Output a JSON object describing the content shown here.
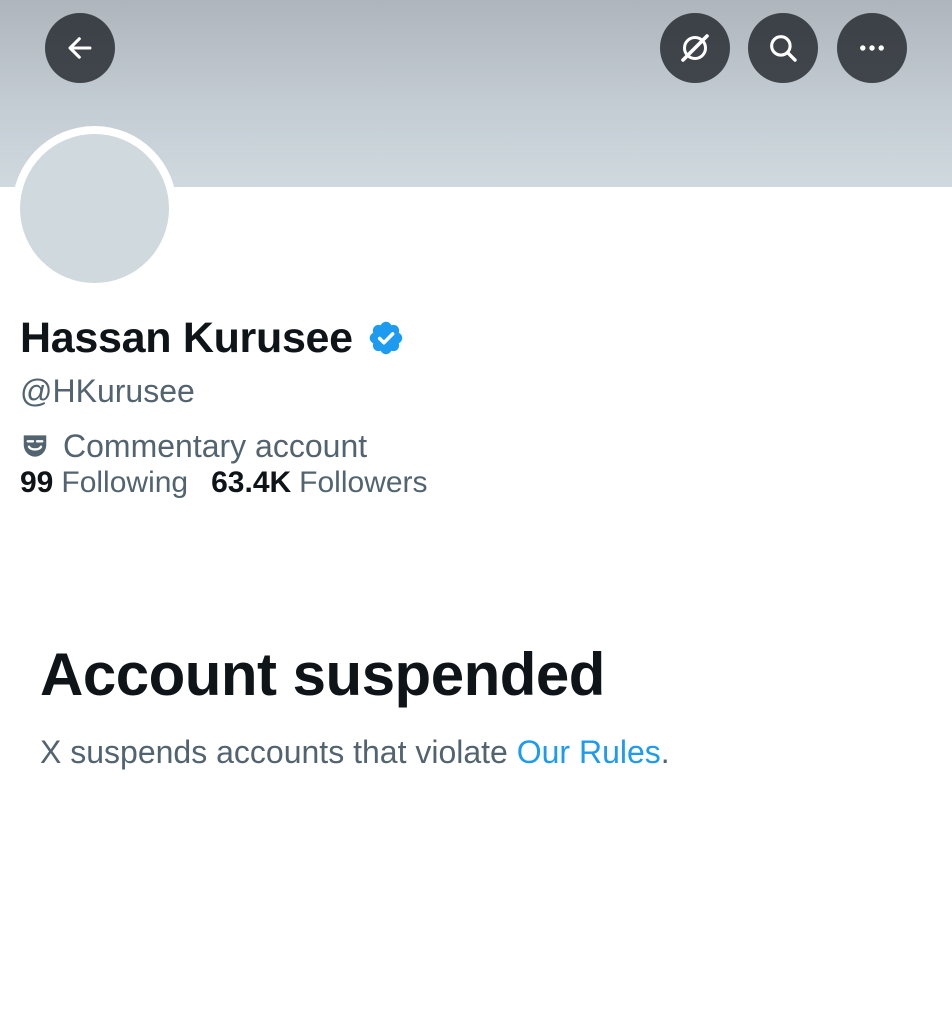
{
  "header": {
    "back_icon": "arrow-left-icon",
    "grok_icon": "grok-icon",
    "search_icon": "search-icon",
    "more_icon": "more-horizontal-icon",
    "button_bg": "#0f1419"
  },
  "profile": {
    "display_name": "Hassan Kurusee",
    "verified_icon": "verified-badge-icon",
    "verified_color": "#1d9bf0",
    "handle": "@HKurusee",
    "label_icon": "masks-icon",
    "label": "Commentary account",
    "following_count": "99",
    "following_label": "Following",
    "followers_count": "63.4K",
    "followers_label": "Followers"
  },
  "suspension": {
    "title": "Account suspended",
    "message_prefix": "X suspends accounts that violate ",
    "link_text": "Our Rules",
    "message_suffix": "."
  },
  "colors": {
    "primary_text": "#0f1419",
    "secondary_text": "#536471",
    "link": "#1d9bf0",
    "banner": "#cfd9de"
  }
}
